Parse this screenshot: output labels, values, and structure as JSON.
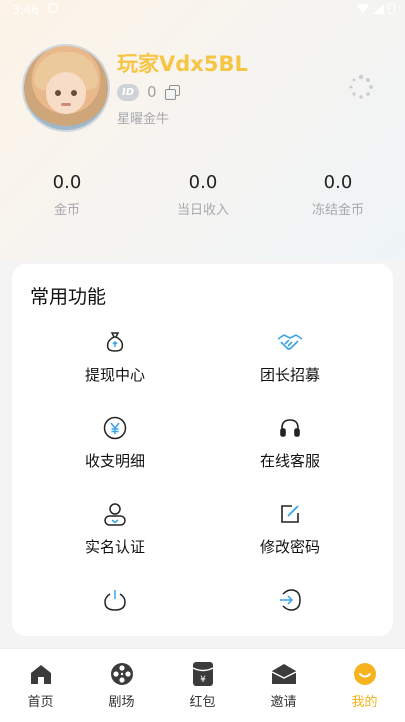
{
  "status_bar": {
    "time": "3:46"
  },
  "profile": {
    "username": "玩家Vdx5BL",
    "id_badge": "ID",
    "id_value": "0",
    "level": "星曜金牛"
  },
  "stats": [
    {
      "value": "0.0",
      "label": "金币"
    },
    {
      "value": "0.0",
      "label": "当日收入"
    },
    {
      "value": "0.0",
      "label": "冻结金币"
    }
  ],
  "functions": {
    "title": "常用功能",
    "items": [
      {
        "label": "提现中心",
        "icon": "money-bag-icon"
      },
      {
        "label": "团长招募",
        "icon": "handshake-icon"
      },
      {
        "label": "收支明细",
        "icon": "yen-circle-icon"
      },
      {
        "label": "在线客服",
        "icon": "headset-icon"
      },
      {
        "label": "实名认证",
        "icon": "user-verify-icon"
      },
      {
        "label": "修改密码",
        "icon": "edit-icon"
      },
      {
        "label": "",
        "icon": "power-icon"
      },
      {
        "label": "",
        "icon": "logout-icon"
      }
    ]
  },
  "tabs": [
    {
      "label": "首页",
      "icon": "home-icon"
    },
    {
      "label": "剧场",
      "icon": "film-reel-icon"
    },
    {
      "label": "红包",
      "icon": "red-envelope-icon"
    },
    {
      "label": "邀请",
      "icon": "envelope-icon"
    },
    {
      "label": "我的",
      "icon": "smile-icon",
      "active": true
    }
  ],
  "colors": {
    "accent": "#f6c544",
    "active_tab": "#f6b31e"
  }
}
